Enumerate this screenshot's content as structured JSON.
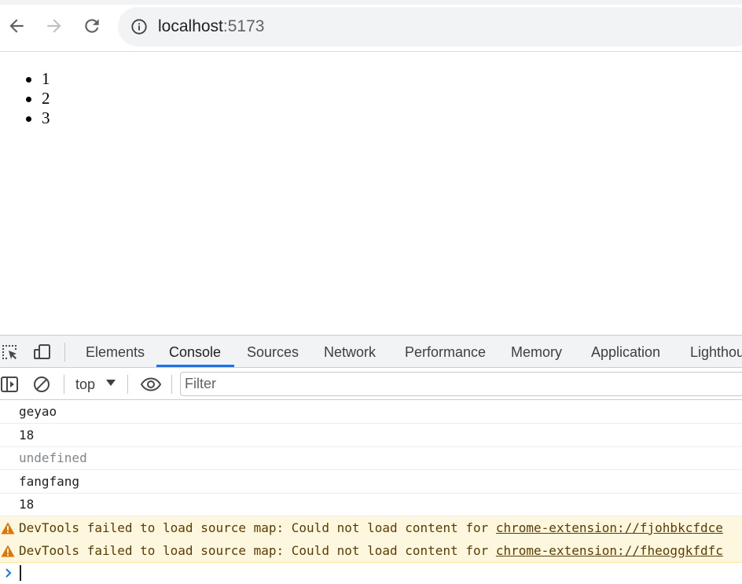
{
  "browser": {
    "url_host": "localhost",
    "url_port": ":5173"
  },
  "page": {
    "list_items": [
      "1",
      "2",
      "3"
    ]
  },
  "devtools": {
    "tabs": [
      {
        "label": "Elements",
        "active": false
      },
      {
        "label": "Console",
        "active": true
      },
      {
        "label": "Sources",
        "active": false
      },
      {
        "label": "Network",
        "active": false
      },
      {
        "label": "Performance",
        "active": false
      },
      {
        "label": "Memory",
        "active": false
      },
      {
        "label": "Application",
        "active": false
      },
      {
        "label": "Lighthou",
        "active": false
      }
    ],
    "context": "top",
    "filter_placeholder": "Filter",
    "accent_color": "#1a73e8",
    "warning_bg": "#fef7e0"
  },
  "console": {
    "messages": [
      {
        "text": "geyao",
        "kind": "log"
      },
      {
        "text": "18",
        "kind": "log"
      },
      {
        "text": "undefined",
        "kind": "undefined"
      },
      {
        "text": "fangfang",
        "kind": "log"
      },
      {
        "text": "18",
        "kind": "log"
      }
    ],
    "warnings": [
      {
        "text": "DevTools failed to load source map: Could not load content for ",
        "link": "chrome-extension://fjohbkcfdce"
      },
      {
        "text": "DevTools failed to load source map: Could not load content for ",
        "link": "chrome-extension://fheoggkfdfc"
      }
    ]
  }
}
